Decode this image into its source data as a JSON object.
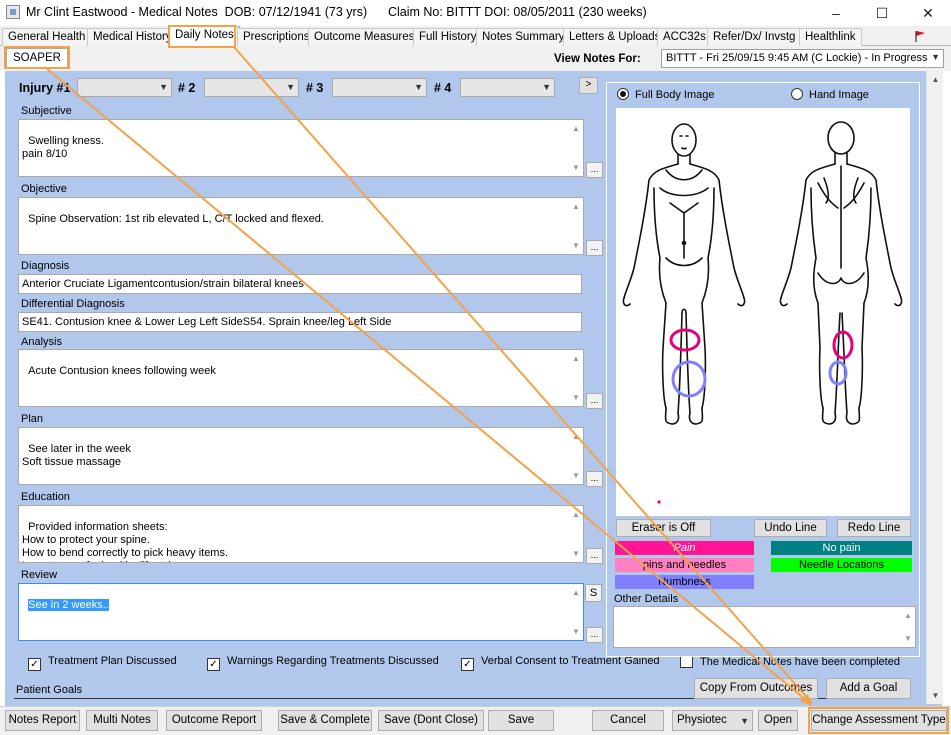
{
  "window": {
    "title": "Mr Clint Eastwood - Medical Notes  DOB: 07/12/1941 (73 yrs)      Claim No: BITTT DOI: 08/05/2011 (230 weeks)",
    "minimize": "–",
    "maximize": "☐",
    "close": "✕"
  },
  "tabs": [
    {
      "label": "General Health"
    },
    {
      "label": "Medical History"
    },
    {
      "label": "Daily Notes"
    },
    {
      "label": "Prescriptions"
    },
    {
      "label": "Outcome Measures"
    },
    {
      "label": "Full History"
    },
    {
      "label": "Notes Summary"
    },
    {
      "label": "Letters & Uploads"
    },
    {
      "label": "ACC32s"
    },
    {
      "label": "Refer/Dx/ Invstg"
    },
    {
      "label": "Healthlink"
    }
  ],
  "subtab": {
    "label": "SOAPER"
  },
  "view_notes": {
    "label": "View Notes For:",
    "selected": "BITTT - Fri 25/09/15 9:45 AM (C Lockie) - In Progress"
  },
  "injury": {
    "label1": "Injury #1",
    "label2": "# 2",
    "label3": "# 3",
    "label4": "# 4",
    "next": ">"
  },
  "fields": {
    "subjective": {
      "label": "Subjective",
      "value": "Swelling kness.\npain 8/10"
    },
    "objective": {
      "label": "Objective",
      "value": "Spine Observation: 1st rib elevated L, C/T locked and flexed."
    },
    "diagnosis": {
      "label": "Diagnosis",
      "value": "Anterior Cruciate Ligamentcontusion/strain bilateral knees"
    },
    "differential": {
      "label": "Differential Diagnosis",
      "value": "SE41. Contusion knee & Lower Leg Left SideS54. Sprain knee/leg Left Side"
    },
    "analysis": {
      "label": "Analysis",
      "value": "Acute Contusion knees following week"
    },
    "plan": {
      "label": "Plan",
      "value": "See later in the week\nSoft tissue massage"
    },
    "education": {
      "label": "Education",
      "value": "Provided information sheets:\nHow to protect your spine.\nHow to bend correctly to pick heavy items.\nImportance of a healthy lifestyle."
    },
    "review": {
      "label": "Review",
      "value": "See in 2 weeks.."
    }
  },
  "ellipsis": "...",
  "s_button": "S",
  "checkboxes": [
    {
      "label": "Treatment Plan Discussed",
      "checked": true
    },
    {
      "label": "Warnings Regarding Treatments Discussed",
      "checked": true
    },
    {
      "label": "Verbal Consent to Treatment Gained",
      "checked": true
    },
    {
      "label": "The Medical Notes have been completed",
      "checked": false
    }
  ],
  "check_mark": "✓",
  "patient_goals": {
    "label": "Patient Goals"
  },
  "body_panel": {
    "full_body": "Full Body Image",
    "hand": "Hand Image",
    "selected": "full_body",
    "eraser": "Eraser is Off",
    "undo": "Undo Line",
    "redo": "Redo Line",
    "legend": [
      {
        "label": "Pain",
        "color": "#ff1493"
      },
      {
        "label": "No pain",
        "color": "#008080"
      },
      {
        "label": "pins and needles",
        "color": "#ff80c0"
      },
      {
        "label": "Needle Locations",
        "color": "#00ff00"
      },
      {
        "label": "Numbness",
        "color": "#8080ff"
      }
    ],
    "other_details": "Other Details",
    "copy_outcomes": "Copy From Outcomes",
    "add_goal": "Add a Goal"
  },
  "bottom": {
    "notes_report": "Notes Report",
    "multi_notes": "Multi Notes",
    "outcome_report": "Outcome Report",
    "save_complete": "Save & Complete",
    "save_dont_close": "Save (Dont Close)",
    "save": "Save",
    "cancel": "Cancel",
    "practitioner": "Physiotec",
    "open": "Open",
    "change_assessment": "Change Assessment Type"
  },
  "colors": {
    "panel_blue": "#b1c7ec",
    "highlight_orange": "#f4a14a",
    "flag_red": "#d9161c"
  }
}
